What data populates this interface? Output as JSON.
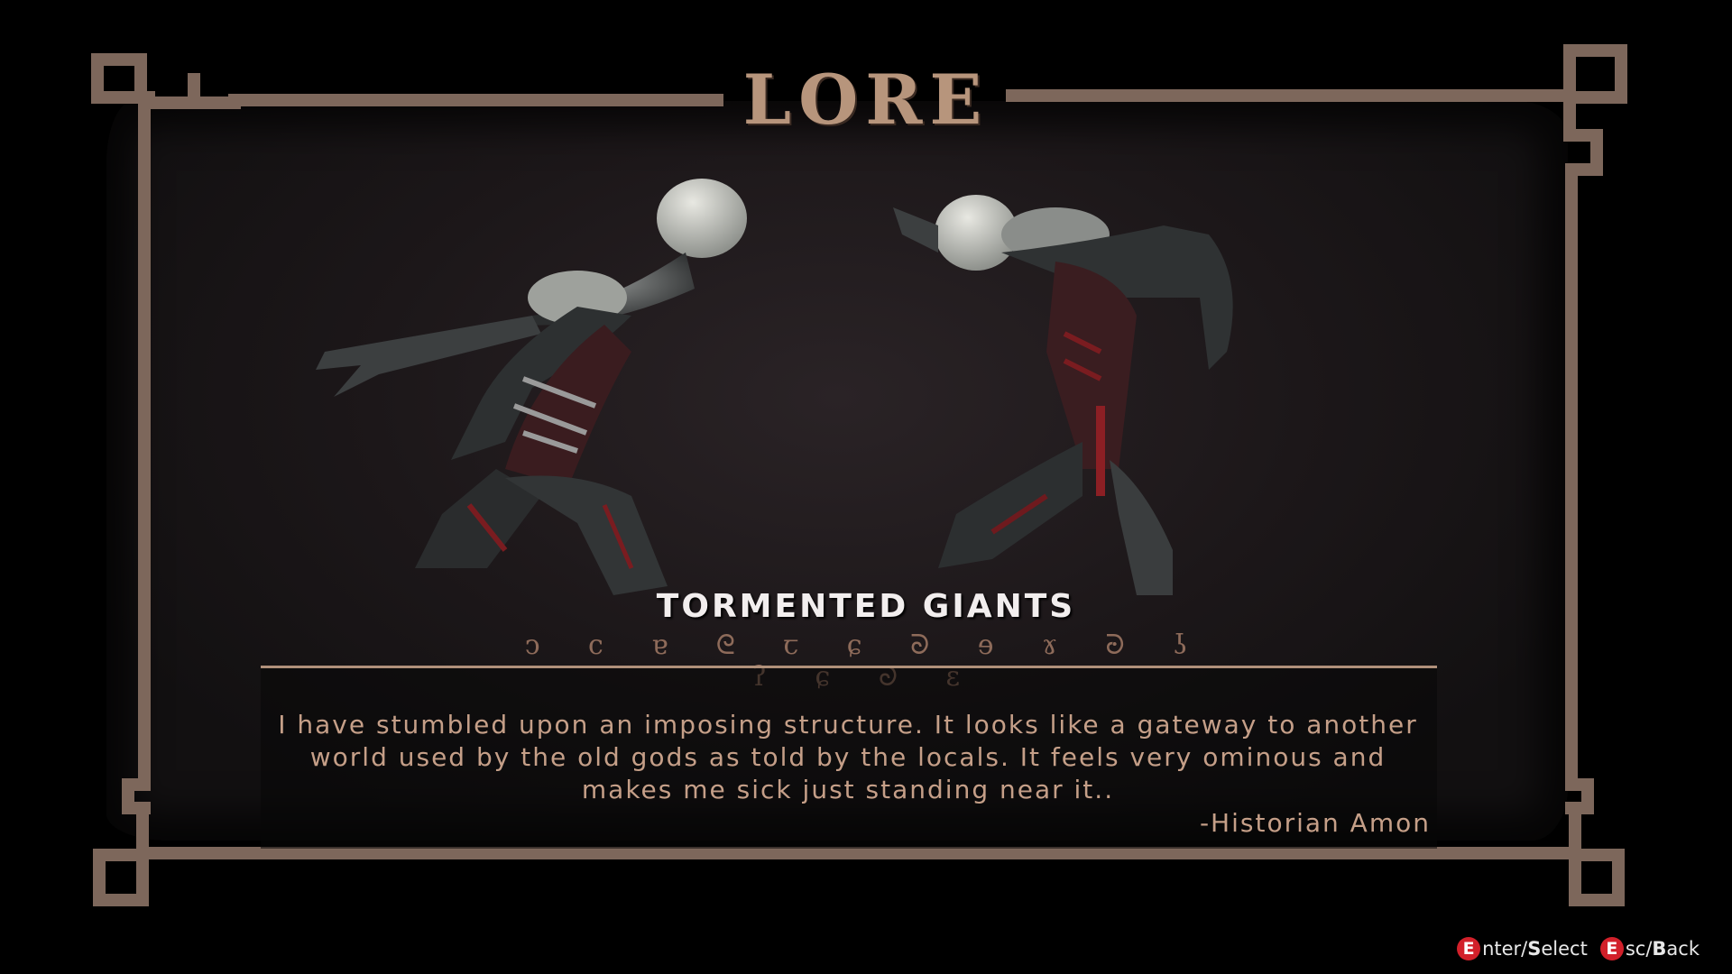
{
  "screen": {
    "title": "LORE"
  },
  "entry": {
    "name": "TORMENTED GIANTS",
    "runes": "ↄ c ɐ ᘓ ꞇ ɕ ᘐ ɘ ɤ ᘒ ʖ ʔ ɕ ᘐ ɛ",
    "lore_text": "I have stumbled upon an imposing structure. It looks like a gateway to another world used by the old gods as told by the locals. It feels very ominous and makes me sick just standing near it..",
    "author": "-Historian Amon"
  },
  "controls": {
    "select": {
      "key": "E",
      "label": "nter/",
      "key2": "S",
      "label2": "elect"
    },
    "back": {
      "key": "E",
      "label": "sc/",
      "key2": "B",
      "label2": "ack"
    }
  },
  "colors": {
    "frame": "#7d675b",
    "title": "#b7957c",
    "lore_text": "#c59f88",
    "key_badge": "#d2202a"
  }
}
